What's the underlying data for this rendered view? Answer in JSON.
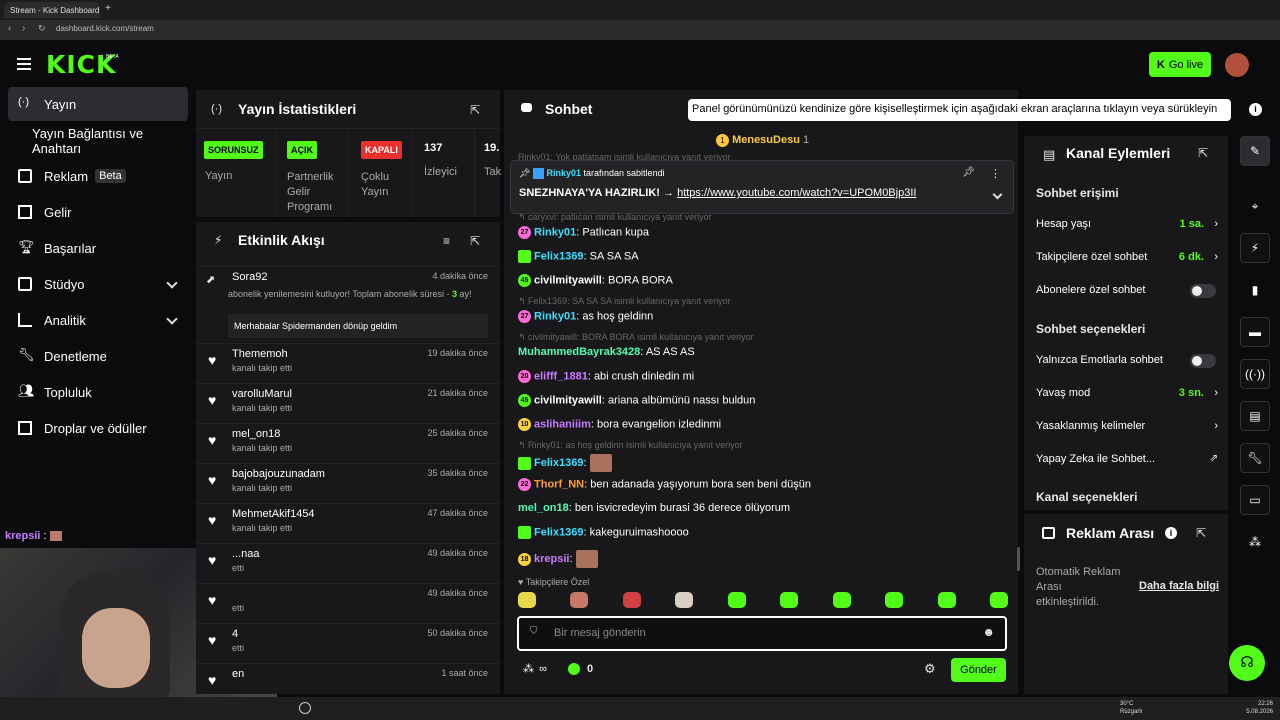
{
  "browser": {
    "tab_title": "Stream - Kick Dashboard",
    "url": "dashboard.kick.com/stream"
  },
  "header": {
    "logo": "KICK",
    "logo_badge": "BETA",
    "go_live": "Go live",
    "tooltip": "Panel görünümünüzü kendinize göre kişiselleştirmek için aşağıdaki ekran araçlarına tıklayın veya sürükleyin"
  },
  "nav": {
    "items": [
      {
        "label": "Yayın",
        "icon": "broadcast-icon"
      },
      {
        "label": "Yayın Bağlantısı ve Anahtarı",
        "icon": ""
      },
      {
        "label": "Reklam",
        "icon": "ad-icon",
        "badge": "Beta"
      },
      {
        "label": "Gelir",
        "icon": "chart-icon"
      },
      {
        "label": "Başarılar",
        "icon": "trophy-icon"
      },
      {
        "label": "Stüdyo",
        "icon": "studio-icon"
      },
      {
        "label": "Analitik",
        "icon": "analytics-icon"
      },
      {
        "label": "Denetleme",
        "icon": "wrench-icon"
      },
      {
        "label": "Topluluk",
        "icon": "community-icon"
      },
      {
        "label": "Droplar ve ödüller",
        "icon": "gift-icon"
      }
    ]
  },
  "stats": {
    "title": "Yayın İstatistikleri",
    "cols": [
      {
        "badge": "SORUNSUZ",
        "label": "Yayın"
      },
      {
        "badge": "AÇIK",
        "label": "Partnerlik Gelir Programı"
      },
      {
        "badge": "KAPALI",
        "label": "Çoklu Yayın"
      },
      {
        "value": "137",
        "label": "İzleyici"
      },
      {
        "value": "19.",
        "label": "Tak"
      }
    ]
  },
  "activity": {
    "title": "Etkinlik Akışı",
    "first": {
      "name": "Sora92",
      "time": "4 dakika önce",
      "text": "abonelik yenilemesini kutluyor! Toplam abonelik süresi -",
      "highlight": "3",
      "tail": "ay!",
      "message": "Merhabalar Spidermanden dönüp geldim"
    },
    "rows": [
      {
        "name": "Thememoh",
        "sub": "kanalı takip etti",
        "time": "19 dakika önce"
      },
      {
        "name": "varolluMarul",
        "sub": "kanalı takip etti",
        "time": "21 dakika önce"
      },
      {
        "name": "mel_on18",
        "sub": "kanalı takip etti",
        "time": "25 dakika önce"
      },
      {
        "name": "bajobajouzunadam",
        "sub": "kanalı takip etti",
        "time": "35 dakika önce"
      },
      {
        "name": "MehmetAkif1454",
        "sub": "kanalı takip etti",
        "time": "47 dakika önce"
      },
      {
        "name": "...naa",
        "sub": "etti",
        "time": "49 dakika önce"
      },
      {
        "name": "",
        "sub": "etti",
        "time": "49 dakika önce"
      },
      {
        "name": "4",
        "sub": "etti",
        "time": "50 dakika önce"
      },
      {
        "name": "en",
        "sub": "",
        "time": "1 saat önce"
      }
    ]
  },
  "overlay_chat": {
    "user": "krepsii",
    "sep": ":"
  },
  "chat": {
    "title": "Sohbet",
    "top_user": "MenesuDesu",
    "top_count": "1",
    "pinned_by": "Rinky01",
    "pinned_suffix": "tarafından sabitlendi",
    "pinned_text": "SNEZHNAYA'YA HAZIRLIK! →",
    "pinned_link": "https://www.youtube.com/watch?v=UPOM0Bjp3II",
    "pinned_hidden_reply": "Rinky01: Yok patlatsam isimli kullanıcıya yanıt veriyor",
    "messages": [
      {
        "reply": "caryxvi: patlıcan isimli kullanıcıya yanıt veriyor"
      },
      {
        "badge": "27",
        "badge_color": "#ff6bd6",
        "user": "Rinky01",
        "color": "#3ce0ff",
        "text": "Patlıcan kupa"
      },
      {
        "badge": "",
        "badge_color": "#53fc18",
        "user": "Felix1369",
        "color": "#3ce0ff",
        "text": "SA SA SA"
      },
      {
        "badge": "45",
        "badge_color": "#53fc18",
        "user": "civilmityawill",
        "color": "#ffffff",
        "text": "BORA BORA"
      },
      {
        "reply": "Felix1369: SA SA SA isimli kullanıcıya yanıt veriyor"
      },
      {
        "badge": "27",
        "badge_color": "#ff6bd6",
        "user": "Rinky01",
        "color": "#3ce0ff",
        "text": "as hoş geldinn"
      },
      {
        "reply": "civilmityawill: BORA BORA isimli kullanıcıya yanıt veriyor"
      },
      {
        "badge": "",
        "badge_color": "",
        "user": "MuhammedBayrak3428",
        "color": "#53fcb0",
        "text": "AS AS AS"
      },
      {
        "badge": "20",
        "badge_color": "#ff6bd6",
        "user": "elifff_1881",
        "color": "#c77dff",
        "text": "abi crush dinledin mi"
      },
      {
        "badge": "45",
        "badge_color": "#53fc18",
        "user": "civilmityawill",
        "color": "#ffffff",
        "text": "ariana albümünü nassı buldun"
      },
      {
        "badge": "10",
        "badge_color": "#ffd23c",
        "user": "aslihaniiim",
        "color": "#c77dff",
        "text": "bora evangelion izledinmi"
      },
      {
        "reply": "Rinky01: as hoş geldinn isimli kullanıcıya yanıt veriyor"
      },
      {
        "badge": "",
        "badge_color": "#53fc18",
        "user": "Felix1369",
        "color": "#3ce0ff",
        "text": ""
      },
      {
        "badge": "22",
        "badge_color": "#ff6bd6",
        "user": "Thorf_NN",
        "color": "#ff9f3c",
        "text": "ben adanada yaşıyorum bora sen beni düşün"
      },
      {
        "badge": "",
        "badge_color": "",
        "user": "mel_on18",
        "color": "#53fcb0",
        "text": "ben isvicredeyim burasi 36 derece ölüyorum"
      },
      {
        "badge": "",
        "badge_color": "#53fc18",
        "user": "Felix1369",
        "color": "#3ce0ff",
        "text": "kakeguruimashoooo"
      },
      {
        "badge": "18",
        "badge_color": "#ffd23c",
        "user": "krepsii",
        "color": "#c77dff",
        "text": ""
      }
    ],
    "emote_section": "Takipçilere Özel",
    "input_placeholder": "Bir mesaj gönderin",
    "points": "0",
    "send": "Gönder"
  },
  "channel": {
    "title": "Kanal Eylemleri",
    "chat_access": "Sohbet erişimi",
    "account_age": "Hesap yaşı",
    "account_age_val": "1 sa.",
    "followers_chat": "Takipçilere özel sohbet",
    "followers_chat_val": "6 dk.",
    "subs_chat": "Abonelere özel sohbet",
    "chat_options": "Sohbet seçenekleri",
    "emote_only": "Yalnızca Emotlarla sohbet",
    "slow_mode": "Yavaş mod",
    "slow_mode_val": "3 sn.",
    "banned_words": "Yasaklanmış kelimeler",
    "ai_chat": "Yapay Zeka ile Sohbet...",
    "channel_options": "Kanal seçenekleri"
  },
  "ads": {
    "title": "Reklam Arası",
    "text": "Otomatik Reklam Arası etkinleştirildi.",
    "link": "Daha fazla bilgi"
  },
  "taskbar": {
    "weather": "30°C",
    "weather_sub": "Rüzgarlı",
    "time": "22:26",
    "date": "5.08.2026"
  }
}
